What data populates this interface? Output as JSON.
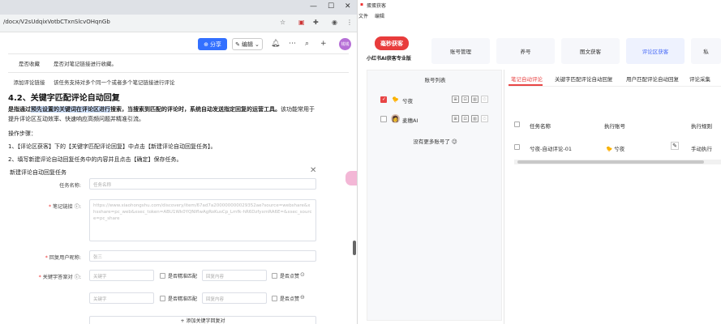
{
  "browser": {
    "url": "/docx/V2sUdqixVotbCTxnSlcvOHqnGb"
  },
  "doc_toolbar": {
    "share_label": "分享",
    "edit_label": "编辑",
    "avatar_text": "钱钱"
  },
  "doc": {
    "table_rows": [
      {
        "name": "是否收藏",
        "desc": "是否对笔记链接进行收藏。"
      },
      {
        "name": "添加评论链接",
        "desc": "该任务支持对多个同一个或者多个笔记链接进行评论"
      }
    ],
    "heading": "4.2、关键字匹配评论自动回复",
    "para_part1": "是指通过",
    "para_highlight": "预先设置的关键词在评论区进行",
    "para_part2": "搜索，当搜索到匹配的评论时，系统自动发送指定回复的运营工具。",
    "para_part3": "该功能常用于提升评论区互动效率、快速响应高频问题并精准引流。",
    "steps_title": "操作步骤：",
    "step1": "1、【评论区获客】下的【关键字匹配评论回复】中点击【新建评论自动回复任务】。",
    "step2": "2、填写新建评论自动回复任务中的内容并且点击【确定】保存任务。"
  },
  "dialog": {
    "title": "新建评论自动回复任务",
    "task_name_label": "任务名称:",
    "task_name_placeholder": "任务名称",
    "note_link_label": "笔记链接",
    "note_link_placeholder": "https://www.xiaohongshu.com/discovery/item/67ad7a200000000029352ae?source=webshare&xhsshare=pc_web&xsec_token=ABU1Wk0YQNIflwAgRoKusCp_Lmfk-hR6DzfyxmRA6E=&xsec_source=pc_share",
    "reply_user_label": "回复用户昵称:",
    "reply_user_placeholder": "张三",
    "keyword_label": "关键字答案对",
    "keyword_placeholder": "关键字",
    "exact_match_label": "是否精准匹配",
    "reply_content_placeholder": "回复内容",
    "like_label": "是否点赞",
    "add_pair_label": "+ 添加关键字回复对"
  },
  "right_app": {
    "menu_file": "文件",
    "menu_edit": "编辑",
    "window_title": "蛋蛋获客",
    "logo_text": "毫秒获客",
    "logo_sub": "小红书AI获客专业版",
    "nav_tabs": [
      "账号管理",
      "养号",
      "图文获客",
      "评论区获客",
      "私"
    ],
    "account_list_title": "账号列表",
    "accounts": [
      {
        "name": "兮夜",
        "checked": true,
        "avatar": "🐤"
      },
      {
        "name": "麦穗AI",
        "checked": false,
        "avatar": "👩"
      }
    ],
    "no_more": "没有更多账号了 😉",
    "sub_tabs": [
      "笔记自动评论",
      "关键字匹配评论自动回复",
      "用户匹配评论自动回复",
      "评论采集"
    ],
    "table_headers": [
      "任务名称",
      "执行账号",
      "执行规则"
    ],
    "table_rows": [
      {
        "task": "兮夜-自动评论-01",
        "account": "兮夜",
        "rule": "手动执行"
      }
    ]
  }
}
